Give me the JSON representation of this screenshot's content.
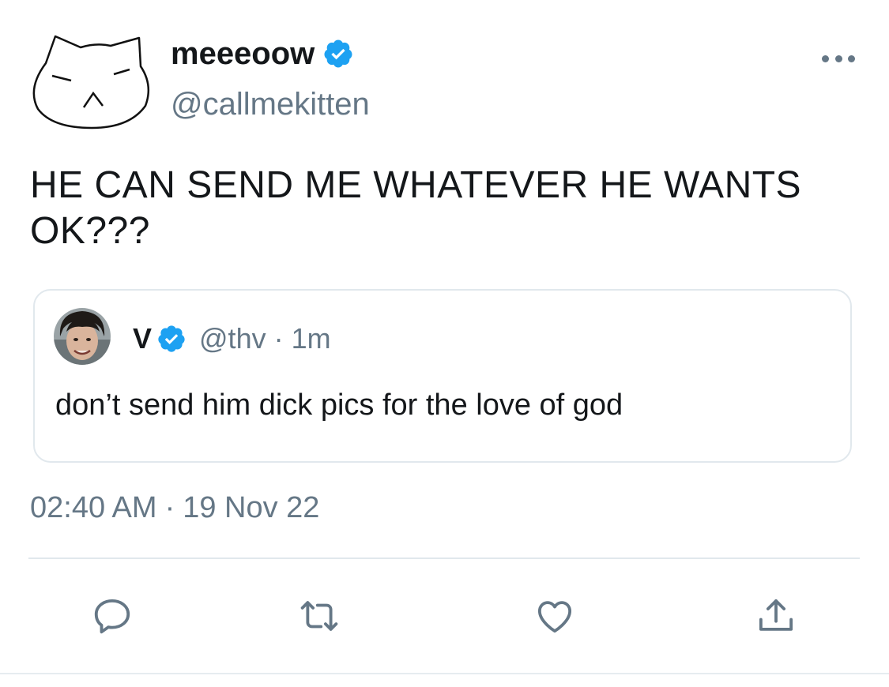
{
  "author": {
    "display_name": "meeeoow",
    "handle": "@callmekitten",
    "verified": true
  },
  "tweet": {
    "text": "HE CAN SEND ME WHATEVER HE WANTS OK???",
    "time": "02:40 AM",
    "separator": "·",
    "date": "19 Nov 22"
  },
  "quoted_tweet": {
    "display_name": "V",
    "handle": "@thv",
    "separator": "·",
    "time": "1m",
    "text": "don’t send him dick pics for the love of god"
  },
  "icons": {
    "more": "more-options-icon",
    "reply": "reply-icon",
    "retweet": "retweet-icon",
    "like": "like-icon",
    "share": "share-icon",
    "verified": "verified-badge-icon"
  },
  "colors": {
    "text": "#14171a",
    "secondary": "#657786",
    "verified": "#1da1f2",
    "border": "#e1e8ed"
  }
}
